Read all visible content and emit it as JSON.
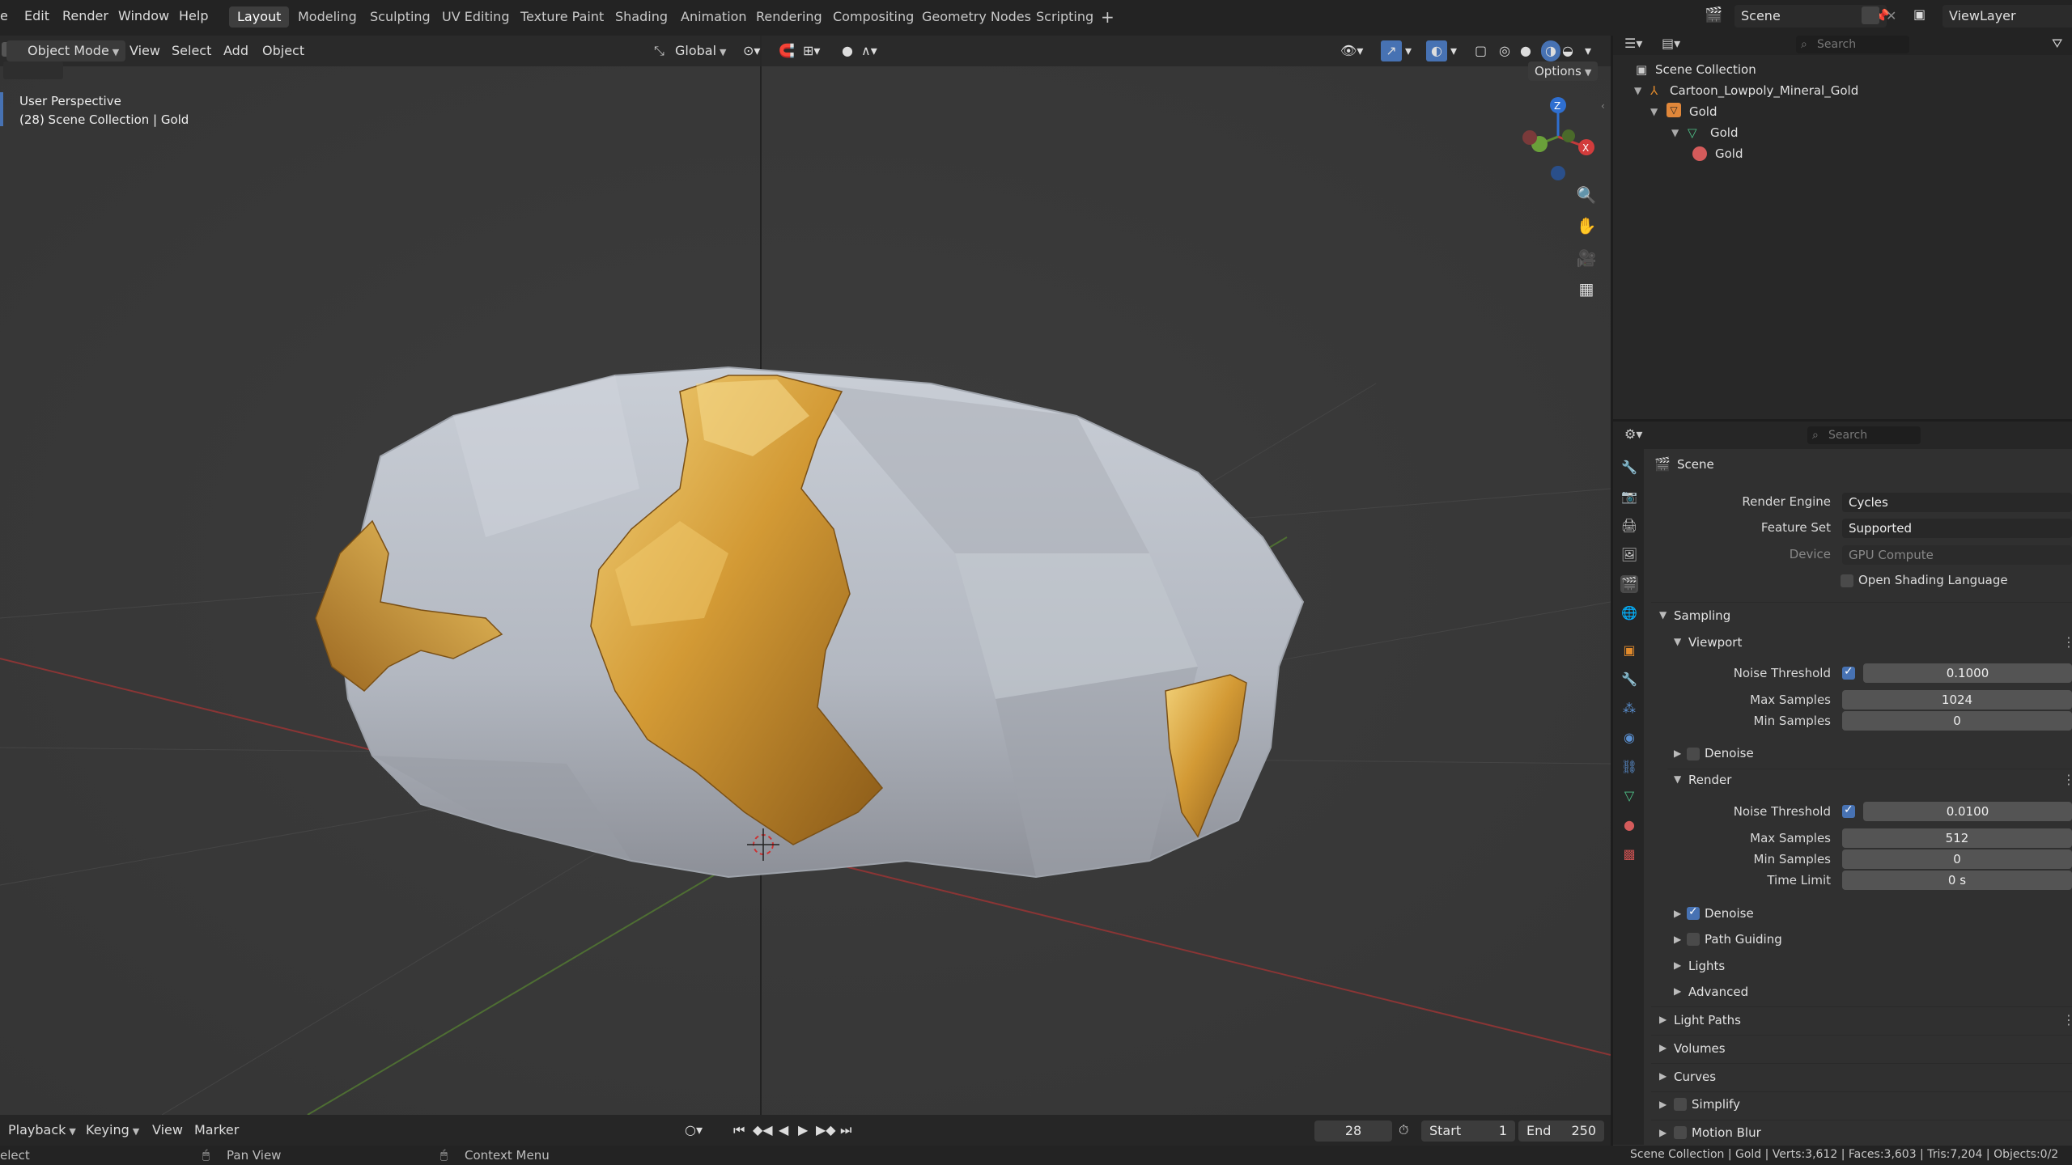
{
  "menu": {
    "file": "e",
    "edit": "Edit",
    "render": "Render",
    "window": "Window",
    "help": "Help"
  },
  "workspaces": [
    "Layout",
    "Modeling",
    "Sculpting",
    "UV Editing",
    "Texture Paint",
    "Shading",
    "Animation",
    "Rendering",
    "Compositing",
    "Geometry Nodes",
    "Scripting"
  ],
  "workspace_add": "+",
  "scene_name": "Scene",
  "view_layer": "ViewLayer",
  "viewport_header": {
    "mode": "Object Mode",
    "view": "View",
    "select": "Select",
    "add": "Add",
    "object": "Object",
    "orientation": "Global",
    "options": "Options"
  },
  "viewport_overlay": {
    "perspective": "User Perspective",
    "collection_info": "(28) Scene Collection | Gold"
  },
  "gizmo": {
    "z": "Z",
    "x": "X"
  },
  "outliner": {
    "search_placeholder": "Search",
    "rows": [
      {
        "label": "Scene Collection"
      },
      {
        "label": "Cartoon_Lowpoly_Mineral_Gold"
      },
      {
        "label": "Gold"
      },
      {
        "label": "Gold"
      },
      {
        "label": "Gold"
      }
    ]
  },
  "properties": {
    "search_placeholder": "Search",
    "context": "Scene",
    "render_engine_label": "Render Engine",
    "render_engine": "Cycles",
    "feature_set_label": "Feature Set",
    "feature_set": "Supported",
    "device_label": "Device",
    "device": "GPU Compute",
    "osl_label": "Open Shading Language",
    "sampling": "Sampling",
    "viewport": "Viewport",
    "vp_noise_label": "Noise Threshold",
    "vp_noise": "0.1000",
    "vp_max_label": "Max Samples",
    "vp_max": "1024",
    "vp_min_label": "Min Samples",
    "vp_min": "0",
    "vp_denoise": "Denoise",
    "render": "Render",
    "r_noise_label": "Noise Threshold",
    "r_noise": "0.0100",
    "r_max_label": "Max Samples",
    "r_max": "512",
    "r_min_label": "Min Samples",
    "r_min": "0",
    "r_time_label": "Time Limit",
    "r_time": "0 s",
    "r_denoise": "Denoise",
    "path_guiding": "Path Guiding",
    "lights": "Lights",
    "advanced": "Advanced",
    "light_paths": "Light Paths",
    "volumes": "Volumes",
    "curves": "Curves",
    "simplify": "Simplify",
    "motion_blur": "Motion Blur"
  },
  "timeline": {
    "playback": "Playback",
    "keying": "Keying",
    "view": "View",
    "marker": "Marker",
    "current_frame": "28",
    "start_label": "Start",
    "start": "1",
    "end_label": "End",
    "end": "250"
  },
  "statusbar": {
    "select": "elect",
    "pan": "Pan View",
    "context": "Context Menu",
    "stats": "Scene Collection | Gold | Verts:3,612 | Faces:3,603 | Tris:7,204 | Objects:0/2"
  },
  "colors": {
    "accent": "#4772b3",
    "gold": "#c9962f",
    "stone": "#b8bdc6",
    "axis_x": "#c33a3a",
    "axis_y": "#5d8a32",
    "axis_z": "#2f6fd0"
  }
}
